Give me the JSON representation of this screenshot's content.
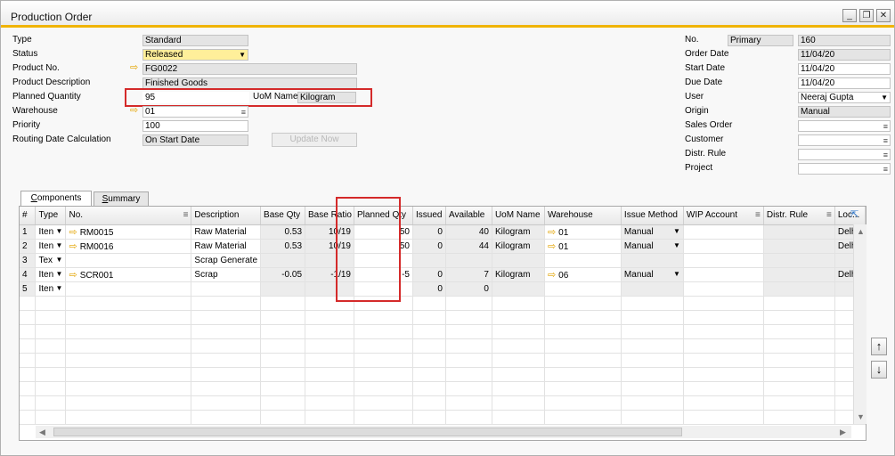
{
  "window": {
    "title": "Production Order",
    "minimize": "_",
    "restore": "❐",
    "close": "✕"
  },
  "left_fields": [
    {
      "label": "Type",
      "value": "Standard"
    },
    {
      "label": "Status",
      "value": "Released"
    },
    {
      "label": "Product No.",
      "value": "FG0022"
    },
    {
      "label": "Product Description",
      "value": "Finished Goods"
    },
    {
      "label": "Planned Quantity",
      "value": "95"
    },
    {
      "label": "Warehouse",
      "value": "01"
    },
    {
      "label": "Priority",
      "value": "100"
    },
    {
      "label": "Routing Date Calculation",
      "value": "On Start Date"
    }
  ],
  "uom": {
    "label": "UoM Name",
    "value": "Kilogram"
  },
  "update_now": "Update Now",
  "right_fields": [
    {
      "label": "No.",
      "value": "160",
      "series": "Primary"
    },
    {
      "label": "Order Date",
      "value": "11/04/20"
    },
    {
      "label": "Start Date",
      "value": "11/04/20"
    },
    {
      "label": "Due Date",
      "value": "11/04/20"
    },
    {
      "label": "User",
      "value": "Neeraj Gupta"
    },
    {
      "label": "Origin",
      "value": "Manual"
    },
    {
      "label": "Sales Order",
      "value": ""
    },
    {
      "label": "Customer",
      "value": ""
    },
    {
      "label": "Distr. Rule",
      "value": ""
    },
    {
      "label": "Project",
      "value": ""
    }
  ],
  "tabs": [
    {
      "label": "Components",
      "underline": "C",
      "rest": "omponents"
    },
    {
      "label": "Summary",
      "underline": "S",
      "rest": "ummary"
    }
  ],
  "grid": {
    "columns": [
      "#",
      "Type",
      "No.",
      "Description",
      "Base Qty",
      "Base Ratio",
      "Planned Qty",
      "Issued",
      "Available",
      "UoM Name",
      "Warehouse",
      "Issue Method",
      "WIP Account",
      "Distr. Rule",
      "Loc..."
    ],
    "rows": [
      [
        "1",
        "Iten",
        "RM0015",
        "Raw Material",
        "0.53",
        "10/19",
        "50",
        "0",
        "40",
        "Kilogram",
        "01",
        "Manual",
        "",
        "",
        "Delhi"
      ],
      [
        "2",
        "Iten",
        "RM0016",
        "Raw Material",
        "0.53",
        "10/19",
        "50",
        "0",
        "44",
        "Kilogram",
        "01",
        "Manual",
        "",
        "",
        "Delhi"
      ],
      [
        "3",
        "Tex",
        "",
        "Scrap Generate",
        "",
        "",
        "",
        "",
        "",
        "",
        "",
        "",
        "",
        "",
        ""
      ],
      [
        "4",
        "Iten",
        "SCR001",
        "Scrap",
        "-0.05",
        "-1/19",
        "-5",
        "0",
        "7",
        "Kilogram",
        "06",
        "Manual",
        "",
        "",
        "Delhi"
      ],
      [
        "5",
        "Iten",
        "",
        "",
        "",
        "",
        "",
        "0",
        "0",
        "",
        "",
        "",
        "",
        "",
        ""
      ]
    ]
  }
}
